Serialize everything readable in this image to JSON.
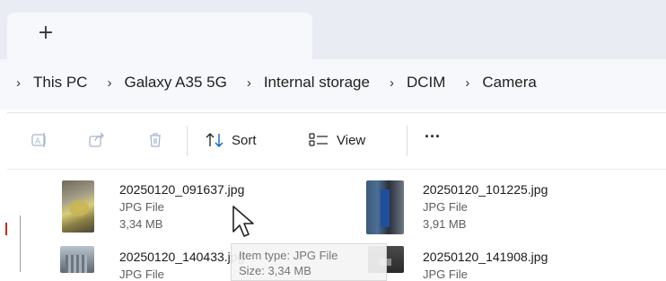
{
  "tabbar": {
    "new_tab_glyph": "+"
  },
  "breadcrumb": {
    "separator": "›",
    "items": [
      "This PC",
      "Galaxy A35 5G",
      "Internal storage",
      "DCIM",
      "Camera"
    ]
  },
  "toolbar": {
    "sort_label": "Sort",
    "view_label": "View",
    "more_label": "···"
  },
  "files": [
    {
      "name": "20250120_091637.jpg",
      "type": "JPG File",
      "size": "3,34 MB"
    },
    {
      "name": "20250120_101225.jpg",
      "type": "JPG File",
      "size": "3,91 MB"
    },
    {
      "name": "20250120_140433.jpg",
      "type": "JPG File",
      "size": ""
    },
    {
      "name": "20250120_141908.jpg",
      "type": "JPG File",
      "size": ""
    }
  ],
  "tooltip": {
    "type_line": "Item type: JPG File",
    "size_line": "Size: 3,34 MB"
  },
  "colors": {
    "accent": "#005fb8",
    "background": "#f7f8fb"
  }
}
